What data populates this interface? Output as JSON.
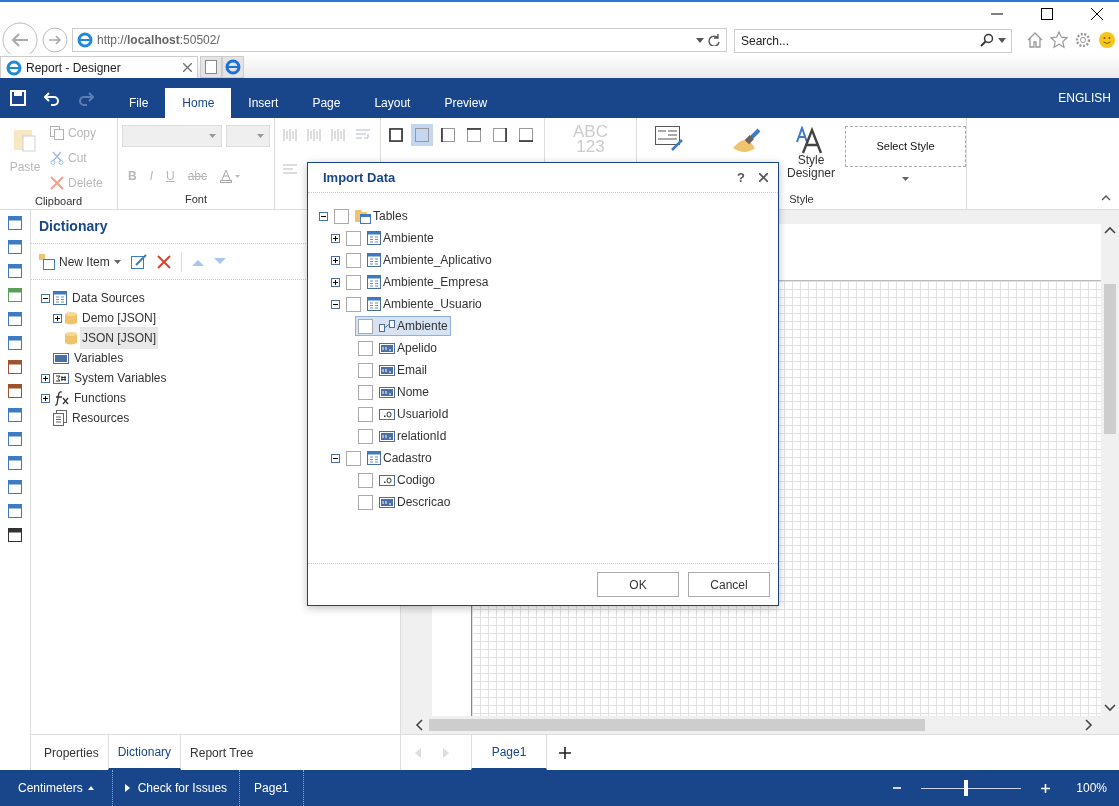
{
  "browser": {
    "address": "http://**localhost**:50502/",
    "search_placeholder": "Search...",
    "tab_title": "Report - Designer"
  },
  "menu_tabs": [
    {
      "label": "File",
      "selected": false
    },
    {
      "label": "Home",
      "selected": true
    },
    {
      "label": "Insert",
      "selected": false
    },
    {
      "label": "Page",
      "selected": false
    },
    {
      "label": "Layout",
      "selected": false
    },
    {
      "label": "Preview",
      "selected": false
    }
  ],
  "language": "ENGLISH",
  "ribbon": {
    "clipboard": {
      "label": "Clipboard",
      "paste": {
        "label": "Paste",
        "disabled": true
      },
      "actions": [
        {
          "label": "Copy",
          "kind": "copy",
          "disabled": true
        },
        {
          "label": "Cut",
          "kind": "cut",
          "disabled": true
        },
        {
          "label": "Delete",
          "kind": "delete",
          "disabled": true
        }
      ]
    },
    "font": {
      "label": "Font",
      "styles": [
        {
          "label": "B",
          "kind": "bold",
          "disabled": true
        },
        {
          "label": "I",
          "kind": "italic",
          "disabled": true
        },
        {
          "label": "U",
          "kind": "underline",
          "disabled": true
        },
        {
          "label": "abc",
          "kind": "strike",
          "disabled": true
        }
      ]
    },
    "format_lines": [
      "ABC",
      "123"
    ],
    "style": {
      "label": "Style",
      "designer": "Style Designer",
      "select": "Select Style"
    }
  },
  "dictionary": {
    "title": "Dictionary",
    "new_item": "New Item",
    "tree": [
      {
        "label": "Data Sources",
        "kind": "datasources",
        "expanded": true,
        "selected": false,
        "children": [
          {
            "label": "Demo [JSON]",
            "kind": "database",
            "expanded": false,
            "selected": false
          },
          {
            "label": "JSON [JSON]",
            "kind": "database",
            "selected": true
          }
        ]
      },
      {
        "label": "Variables",
        "kind": "variables",
        "selected": false
      },
      {
        "label": "System Variables",
        "kind": "sysvars",
        "expanded": false,
        "selected": false
      },
      {
        "label": "Functions",
        "kind": "functions",
        "expanded": false,
        "selected": false
      },
      {
        "label": "Resources",
        "kind": "resources",
        "selected": false
      }
    ]
  },
  "dialog": {
    "title": "Import Data",
    "help": "?",
    "tree": [
      {
        "label": "Tables",
        "kind": "folder",
        "expanded": true,
        "checked": false,
        "selected": false,
        "children": [
          {
            "label": "Ambiente",
            "kind": "table",
            "expanded": false,
            "checked": false,
            "selected": false
          },
          {
            "label": "Ambiente_Aplicativo",
            "kind": "table",
            "expanded": false,
            "checked": false,
            "selected": false
          },
          {
            "label": "Ambiente_Empresa",
            "kind": "table",
            "expanded": false,
            "checked": false,
            "selected": false
          },
          {
            "label": "Ambiente_Usuario",
            "kind": "table",
            "expanded": true,
            "checked": false,
            "selected": false,
            "children": [
              {
                "label": "Ambiente",
                "kind": "relation",
                "checked": false,
                "selected": true
              },
              {
                "label": "Apelido",
                "kind": "string",
                "checked": false,
                "selected": false
              },
              {
                "label": "Email",
                "kind": "string",
                "checked": false,
                "selected": false
              },
              {
                "label": "Nome",
                "kind": "string",
                "checked": false,
                "selected": false
              },
              {
                "label": "UsuarioId",
                "kind": "number",
                "checked": false,
                "selected": false
              },
              {
                "label": "relationId",
                "kind": "string",
                "checked": false,
                "selected": false
              }
            ]
          },
          {
            "label": "Cadastro",
            "kind": "table",
            "expanded": true,
            "checked": false,
            "selected": false,
            "children": [
              {
                "label": "Codigo",
                "kind": "number",
                "checked": false,
                "selected": false
              },
              {
                "label": "Descricao",
                "kind": "string",
                "checked": false,
                "selected": false
              }
            ]
          }
        ]
      }
    ],
    "buttons": [
      "OK",
      "Cancel"
    ]
  },
  "panel_tabs": [
    {
      "label": "Properties",
      "selected": false
    },
    {
      "label": "Dictionary",
      "selected": true
    },
    {
      "label": "Report Tree",
      "selected": false
    }
  ],
  "page_tabs": [
    {
      "label": "Page1",
      "selected": true
    }
  ],
  "status_bar": {
    "units": "Centimeters",
    "check": "Check for Issues",
    "page": "Page1",
    "zoom": {
      "level": 0.45
    },
    "zoom_reading": "100%"
  }
}
